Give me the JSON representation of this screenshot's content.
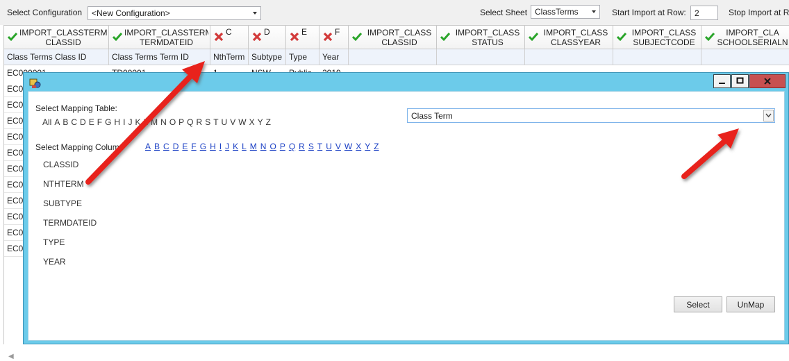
{
  "toolbar": {
    "config_label": "Select Configuration",
    "config_value": "<New Configuration>",
    "sheet_label": "Select Sheet",
    "sheet_value": "ClassTerms",
    "start_label": "Start Import at Row:",
    "start_value": "2",
    "stop_label": "Stop Import at R"
  },
  "grid": {
    "headers": [
      {
        "icon": "check-icon",
        "text": "IMPORT_CLASSTERM\nCLASSID",
        "sub": "Class Terms Class ID"
      },
      {
        "icon": "check-icon",
        "text": "IMPORT_CLASSTERM\nTERMDATEID",
        "sub": "Class Terms Term ID"
      },
      {
        "icon": "x-icon",
        "text": "C",
        "sub": "NthTerm"
      },
      {
        "icon": "x-icon",
        "text": "D",
        "sub": "Subtype"
      },
      {
        "icon": "x-icon",
        "text": "E",
        "sub": "Type"
      },
      {
        "icon": "x-icon",
        "text": "F",
        "sub": "Year"
      },
      {
        "icon": "check-icon",
        "text": "IMPORT_CLASS\nCLASSID",
        "sub": ""
      },
      {
        "icon": "check-icon",
        "text": "IMPORT_CLASS\nSTATUS",
        "sub": ""
      },
      {
        "icon": "check-icon",
        "text": "IMPORT_CLASS\nCLASSYEAR",
        "sub": ""
      },
      {
        "icon": "check-icon",
        "text": "IMPORT_CLASS\nSUBJECTCODE",
        "sub": ""
      },
      {
        "icon": "check-icon",
        "text": "IMPORT_CLA\nSCHOOLSERIALN",
        "sub": ""
      }
    ],
    "first_row": [
      "EC000001",
      "TD00001",
      "1",
      "NSW",
      "Public",
      "2019"
    ],
    "row_prefix": [
      "EC0",
      "EC0",
      "EC0",
      "EC0",
      "EC0",
      "EC0",
      "EC0",
      "EC0",
      "EC0",
      "EC0",
      "EC0"
    ]
  },
  "dialog": {
    "mapping_table_label": "Select Mapping Table:",
    "table_alpha": [
      "All",
      "A",
      "B",
      "C",
      "D",
      "E",
      "F",
      "G",
      "H",
      "I",
      "J",
      "K",
      "L",
      "M",
      "N",
      "O",
      "P",
      "Q",
      "R",
      "S",
      "T",
      "U",
      "V",
      "W",
      "X",
      "Y",
      "Z"
    ],
    "mapping_column_label": "Select Mapping Colum",
    "column_alpha": [
      "A",
      "B",
      "C",
      "D",
      "E",
      "F",
      "G",
      "H",
      "I",
      "J",
      "K",
      "L",
      "M",
      "N",
      "O",
      "P",
      "Q",
      "R",
      "S",
      "T",
      "U",
      "V",
      "W",
      "X",
      "Y",
      "Z"
    ],
    "columns": [
      "CLASSID",
      "NTHTERM",
      "SUBTYPE",
      "TERMDATEID",
      "TYPE",
      "YEAR"
    ],
    "selected_table": "Class Term",
    "select_button": "Select",
    "unmap_button": "UnMap"
  },
  "colors": {
    "dialog_frame": "#6ccbea",
    "check": "#2aa52a",
    "x": "#d23a3a",
    "arrow": "#e8231b",
    "link": "#1a3fc4"
  }
}
